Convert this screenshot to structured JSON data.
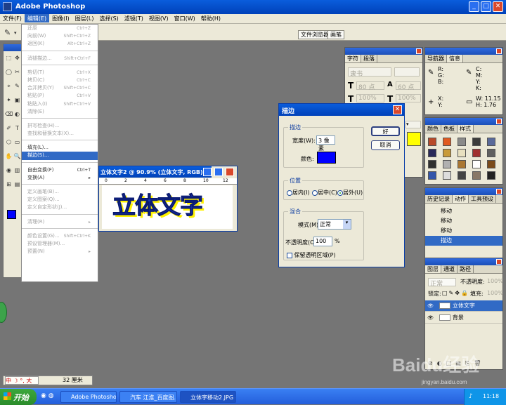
{
  "window": {
    "title": "Adobe Photoshop"
  },
  "menubar": [
    "文件(F)",
    "编辑(E)",
    "图像(I)",
    "图层(L)",
    "选择(S)",
    "滤镜(T)",
    "视图(V)",
    "窗口(W)",
    "帮助(H)"
  ],
  "edit_menu": {
    "items": [
      {
        "label": "还原",
        "shortcut": "Ctrl+Z"
      },
      {
        "label": "向前(W)",
        "shortcut": "Shift+Ctrl+Z"
      },
      {
        "label": "返回(K)",
        "shortcut": "Alt+Ctrl+Z"
      },
      {
        "sep": true
      },
      {
        "label": "消褪描边...",
        "shortcut": "Shift+Ctrl+F"
      },
      {
        "sep": true
      },
      {
        "label": "剪切(T)",
        "shortcut": "Ctrl+X"
      },
      {
        "label": "拷贝(C)",
        "shortcut": "Ctrl+C"
      },
      {
        "label": "合并拷贝(Y)",
        "shortcut": "Shift+Ctrl+C"
      },
      {
        "label": "粘贴(P)",
        "shortcut": "Ctrl+V"
      },
      {
        "label": "粘贴入(I)",
        "shortcut": "Shift+Ctrl+V"
      },
      {
        "label": "清除(E)",
        "shortcut": ""
      },
      {
        "sep": true
      },
      {
        "label": "拼写检查(H)...",
        "shortcut": ""
      },
      {
        "label": "查找和替换文本(X)...",
        "shortcut": ""
      },
      {
        "sep": true
      },
      {
        "label": "填充(L)...",
        "shortcut": ""
      },
      {
        "label": "描边(S)...",
        "shortcut": "",
        "highlight": true
      },
      {
        "sep": true
      },
      {
        "label": "自由变换(F)",
        "shortcut": "Ctrl+T"
      },
      {
        "label": "变换(A)",
        "shortcut": "▸"
      },
      {
        "sep": true
      },
      {
        "label": "定义画笔(B)...",
        "shortcut": ""
      },
      {
        "label": "定义图案(Q)...",
        "shortcut": ""
      },
      {
        "label": "定义自定形状(J)...",
        "shortcut": ""
      },
      {
        "sep": true
      },
      {
        "label": "清理(R)",
        "shortcut": "▸"
      },
      {
        "sep": true
      },
      {
        "label": "颜色设置(G)...",
        "shortcut": "Shift+Ctrl+K"
      },
      {
        "label": "预设管理器(M)...",
        "shortcut": ""
      },
      {
        "label": "预置(N)",
        "shortcut": "▸"
      }
    ]
  },
  "optionbar": {
    "tabs": [
      "文件浏览器",
      "画笔"
    ]
  },
  "doc_window": {
    "title": "立体文字2 @ 90.9% (立体文字, RGB)",
    "text": "立体文字",
    "ruler": [
      "0",
      "2",
      "4",
      "6",
      "8",
      "10",
      "12"
    ]
  },
  "stroke_dialog": {
    "title": "描边",
    "ok": "好",
    "cancel": "取消",
    "stroke_group": "描边",
    "width_label": "宽度(W):",
    "width_value": "3 像素",
    "color_label": "颜色:",
    "color": "#0000ff",
    "position_group": "位置",
    "pos_inside": "居内(I)",
    "pos_center": "居中(C)",
    "pos_outside": "居外(U)",
    "blend_group": "混合",
    "mode_label": "模式(M):",
    "mode_value": "正常",
    "opacity_label": "不透明度(O):",
    "opacity_value": "100",
    "opacity_unit": "%",
    "preserve_label": "保留透明区域(P)"
  },
  "char_panel": {
    "tabs": [
      "字符",
      "段落"
    ],
    "font": "隶书",
    "size1": "80 点",
    "size2": "60 点",
    "pct1": "100%",
    "pct2": "100%"
  },
  "nav_panel": {
    "tabs": [
      "导航器",
      "信息"
    ],
    "rgb": [
      "R:",
      "G:",
      "B:"
    ],
    "cmyk": [
      "C:",
      "M:",
      "Y:",
      "K:"
    ],
    "xy": [
      "X:",
      "Y:"
    ],
    "w_label": "W:",
    "w_val": "11.15",
    "h_label": "H:",
    "h_val": "1.76"
  },
  "swatch_panel": {
    "tabs": [
      "颜色",
      "色板",
      "样式"
    ]
  },
  "history_panel": {
    "tabs": [
      "历史记录",
      "动作",
      "工具预设"
    ],
    "items": [
      "移动",
      "移动",
      "移动",
      "描边"
    ]
  },
  "layers_panel": {
    "tabs": [
      "图层",
      "通道",
      "路径"
    ],
    "mode": "正常",
    "opacity_label": "不透明度:",
    "opacity": "100%",
    "lock_label": "锁定:",
    "fill_label": "填充:",
    "fill": "100%",
    "layers": [
      "立体文字",
      "背景"
    ]
  },
  "statusbar": {
    "zoom": "中",
    "info": "32 厘米",
    "ime": "中 ☽ °, 大"
  },
  "taskbar": {
    "start": "开始",
    "tasks": [
      "Adobe Photoshop",
      "汽车 江淮_百度图...",
      "立体字移动2.JPG -..."
    ],
    "clock": "11:18"
  },
  "colors": {
    "accent": "#316ac5",
    "foreground": "#0000ff",
    "text_yellow": "#ffff00"
  },
  "watermark": {
    "line1": "Baidu经验",
    "line2": "jingyan.baidu.com"
  }
}
